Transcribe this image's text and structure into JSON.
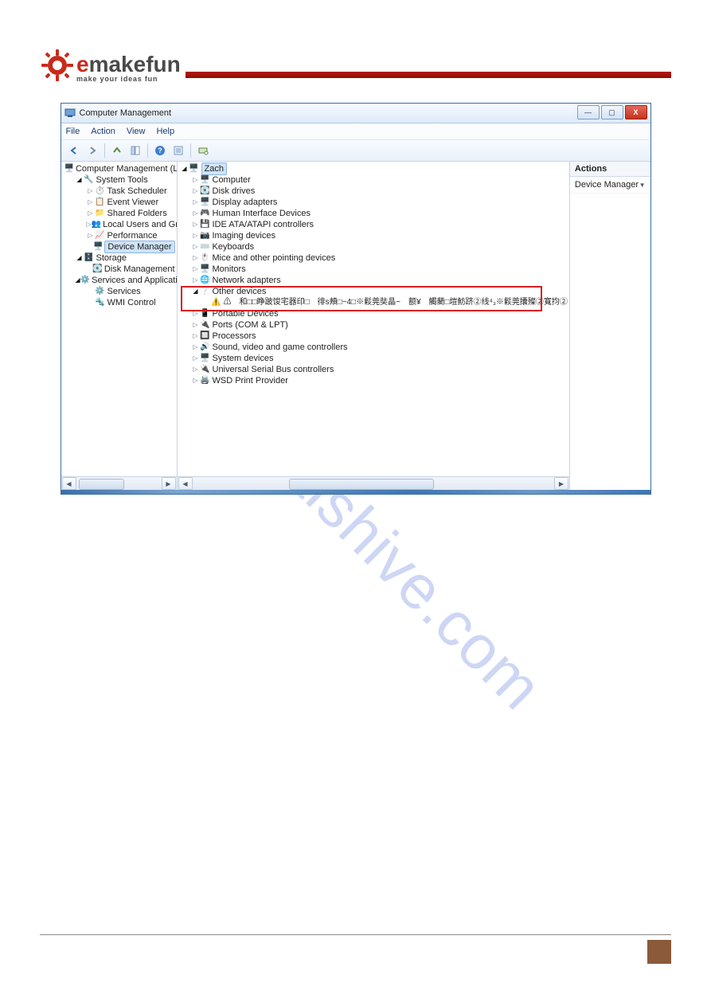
{
  "logo": {
    "e": "e",
    "rest": "makefun",
    "tagline": "make your ideas fun"
  },
  "watermark": "manualshive.com",
  "window": {
    "title": "Computer Management",
    "menu": {
      "file": "File",
      "action": "Action",
      "view": "View",
      "help": "Help"
    },
    "win_controls": {
      "min": "—",
      "max": "▢",
      "close": "X"
    }
  },
  "left_tree": {
    "root": "Computer Management (Local",
    "system_tools": "System Tools",
    "task_scheduler": "Task Scheduler",
    "event_viewer": "Event Viewer",
    "shared_folders": "Shared Folders",
    "local_users": "Local Users and Groups",
    "performance": "Performance",
    "device_manager": "Device Manager",
    "storage": "Storage",
    "disk_management": "Disk Management",
    "services_apps": "Services and Applications",
    "services": "Services",
    "wmi": "WMI Control"
  },
  "mid_tree": {
    "root": "Zach",
    "computer": "Computer",
    "disk_drives": "Disk drives",
    "display_adapters": "Display adapters",
    "hid": "Human Interface Devices",
    "ide": "IDE ATA/ATAPI controllers",
    "imaging": "Imaging devices",
    "keyboards": "Keyboards",
    "mice": "Mice and other pointing devices",
    "monitors": "Monitors",
    "network": "Network adapters",
    "other": "Other devices",
    "unknown": "⚠　和□□睁跛馂宅器印□　徘s頰□~4□※鬏莞奘晶~　额¥　觸藺□塏魴跻②线⁴₃※鬏莞攮殩②寬抣②",
    "portable": "Portable Devices",
    "ports": "Ports (COM & LPT)",
    "processors": "Processors",
    "sound": "Sound, video and game controllers",
    "system_devices": "System devices",
    "usb": "Universal Serial Bus controllers",
    "wsd": "WSD Print Provider"
  },
  "right_pane": {
    "header": "Actions",
    "item": "Device Manager"
  }
}
